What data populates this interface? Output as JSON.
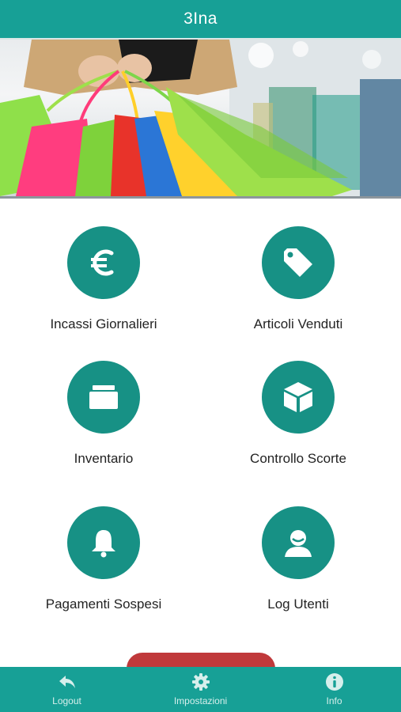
{
  "header": {
    "title": "3Ina"
  },
  "hero": {
    "image": "shopping-bags-photo"
  },
  "menu": [
    {
      "label": "Incassi Giornalieri",
      "icon": "euro-icon"
    },
    {
      "label": "Articoli Venduti",
      "icon": "tag-icon"
    },
    {
      "label": "Inventario",
      "icon": "folder-icon"
    },
    {
      "label": "Controllo Scorte",
      "icon": "box-icon"
    },
    {
      "label": "Pagamenti Sospesi",
      "icon": "bell-icon"
    },
    {
      "label": "Log Utenti",
      "icon": "user-icon"
    }
  ],
  "bottom_nav": [
    {
      "label": "Logout",
      "icon": "reply-arrow-icon"
    },
    {
      "label": "Impostazioni",
      "icon": "gear-icon"
    },
    {
      "label": "Info",
      "icon": "info-icon"
    }
  ],
  "colors": {
    "primary": "#17a096",
    "icon_circle": "#179185",
    "partial_button": "#c0393b"
  }
}
